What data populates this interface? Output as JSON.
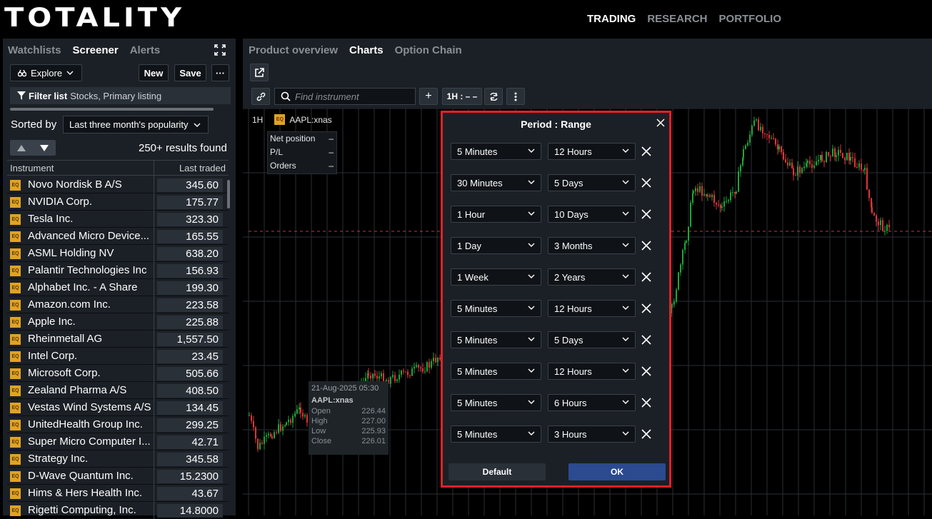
{
  "brand": "TOTALITY",
  "topnav": [
    "TRADING",
    "RESEARCH",
    "PORTFOLIO"
  ],
  "left": {
    "tabs": [
      "Watchlists",
      "Screener",
      "Alerts"
    ],
    "explore_label": "Explore",
    "new_label": "New",
    "save_label": "Save",
    "more_label": "···",
    "filter_label": "Filter list",
    "filter_value": "Stocks, Primary listing",
    "sorted_by_label": "Sorted by",
    "sorted_by_value": "Last three month's popularity",
    "results": "250+ results found",
    "col_instrument": "Instrument",
    "col_last": "Last traded",
    "badge": "EQ",
    "rows": [
      {
        "name": "Novo Nordisk B A/S",
        "price": "345.60"
      },
      {
        "name": "NVIDIA Corp.",
        "price": "175.77"
      },
      {
        "name": "Tesla Inc.",
        "price": "323.30"
      },
      {
        "name": "Advanced Micro Device...",
        "price": "165.55"
      },
      {
        "name": "ASML Holding NV",
        "price": "638.20"
      },
      {
        "name": "Palantir Technologies Inc",
        "price": "156.93"
      },
      {
        "name": "Alphabet Inc. - A Share",
        "price": "199.30"
      },
      {
        "name": "Amazon.com Inc.",
        "price": "223.58"
      },
      {
        "name": "Apple Inc.",
        "price": "225.88"
      },
      {
        "name": "Rheinmetall AG",
        "price": "1,557.50"
      },
      {
        "name": "Intel Corp.",
        "price": "23.45"
      },
      {
        "name": "Microsoft Corp.",
        "price": "505.66"
      },
      {
        "name": "Zealand Pharma A/S",
        "price": "408.50"
      },
      {
        "name": "Vestas Wind Systems A/S",
        "price": "134.45"
      },
      {
        "name": "UnitedHealth Group Inc.",
        "price": "299.25"
      },
      {
        "name": "Super Micro Computer I...",
        "price": "42.71"
      },
      {
        "name": "Strategy Inc.",
        "price": "345.58"
      },
      {
        "name": "D-Wave Quantum Inc.",
        "price": "15.2300"
      },
      {
        "name": "Hims & Hers Health Inc.",
        "price": "43.67"
      },
      {
        "name": "Rigetti Computing, Inc.",
        "price": "14.8000"
      }
    ]
  },
  "right": {
    "tabs": [
      "Product overview",
      "Charts",
      "Option Chain"
    ],
    "find_placeholder": "Find instrument",
    "period_btn": "1H : – –",
    "plus_label": "+",
    "interval": "1H",
    "symbol": "AAPL:xnas",
    "badge": "EQ",
    "position": [
      {
        "label": "Net position",
        "value": "–"
      },
      {
        "label": "P/L",
        "value": "–"
      },
      {
        "label": "Orders",
        "value": "–"
      }
    ],
    "tooltip": {
      "time": "21-Aug-2025 05:30",
      "symbol": "AAPL:xnas",
      "fields": [
        {
          "k": "Open",
          "v": "226.44"
        },
        {
          "k": "High",
          "v": "227.00"
        },
        {
          "k": "Low",
          "v": "225.93"
        },
        {
          "k": "Close",
          "v": "226.01"
        }
      ]
    }
  },
  "dialog": {
    "title": "Period : Range",
    "rows": [
      {
        "period": "5 Minutes",
        "range": "12 Hours"
      },
      {
        "period": "30 Minutes",
        "range": "5 Days"
      },
      {
        "period": "1 Hour",
        "range": "10 Days"
      },
      {
        "period": "1 Day",
        "range": "3 Months"
      },
      {
        "period": "1 Week",
        "range": "2 Years"
      },
      {
        "period": "5 Minutes",
        "range": "12 Hours"
      },
      {
        "period": "5 Minutes",
        "range": "5 Days"
      },
      {
        "period": "5 Minutes",
        "range": "12 Hours"
      },
      {
        "period": "5 Minutes",
        "range": "6 Hours"
      },
      {
        "period": "5 Minutes",
        "range": "3 Hours"
      }
    ],
    "default_label": "Default",
    "ok_label": "OK"
  },
  "colors": {
    "up": "#1fa53b",
    "down": "#e0343a",
    "accent": "#2b4a8f",
    "highlight": "#e0222a",
    "badge": "#e0a324"
  }
}
